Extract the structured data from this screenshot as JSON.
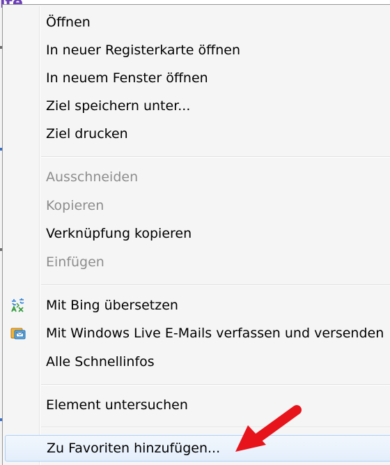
{
  "background": {
    "title_fragment": "ite"
  },
  "menu": {
    "groups": [
      {
        "items": [
          {
            "label": "Öffnen",
            "enabled": true
          },
          {
            "label": "In neuer Registerkarte öffnen",
            "enabled": true
          },
          {
            "label": "In neuem Fenster öffnen",
            "enabled": true
          },
          {
            "label": "Ziel speichern unter...",
            "enabled": true
          },
          {
            "label": "Ziel drucken",
            "enabled": true
          }
        ]
      },
      {
        "items": [
          {
            "label": "Ausschneiden",
            "enabled": false
          },
          {
            "label": "Kopieren",
            "enabled": false
          },
          {
            "label": "Verknüpfung kopieren",
            "enabled": true
          },
          {
            "label": "Einfügen",
            "enabled": false
          }
        ]
      },
      {
        "items": [
          {
            "label": "Mit Bing übersetzen",
            "enabled": true,
            "icon": "translate-icon"
          },
          {
            "label": "Mit Windows Live E-Mails verfassen und versenden",
            "enabled": true,
            "icon": "windows-live-mail-icon"
          },
          {
            "label": "Alle Schnellinfos",
            "enabled": true
          }
        ]
      },
      {
        "items": [
          {
            "label": "Element untersuchen",
            "enabled": true
          }
        ]
      },
      {
        "items": [
          {
            "label": "Zu Favoriten hinzufügen...",
            "enabled": true,
            "highlighted": true
          }
        ]
      }
    ]
  },
  "colors": {
    "menu_background": "#f5f5f5",
    "disabled_text": "#8d8d8d",
    "highlight_border": "#aecff7",
    "annotation_arrow": "#e8141b"
  }
}
